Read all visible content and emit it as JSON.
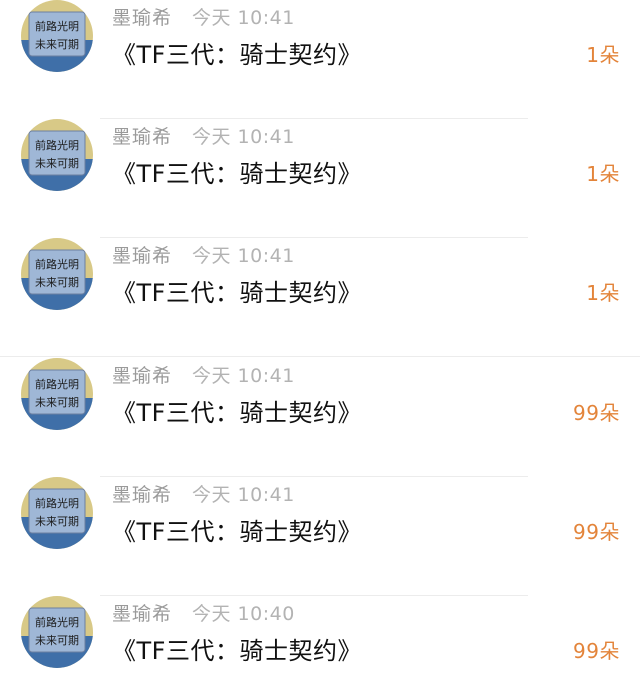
{
  "messages": [
    {
      "sender": "墨瑜希",
      "time": "今天 10:41",
      "gift": "《TF三代：骑士契约》",
      "count": "1朵"
    },
    {
      "sender": "墨瑜希",
      "time": "今天 10:41",
      "gift": "《TF三代：骑士契约》",
      "count": "1朵"
    },
    {
      "sender": "墨瑜希",
      "time": "今天 10:41",
      "gift": "《TF三代：骑士契约》",
      "count": "1朵"
    },
    {
      "sender": "墨瑜希",
      "time": "今天 10:41",
      "gift": "《TF三代：骑士契约》",
      "count": "99朵"
    },
    {
      "sender": "墨瑜希",
      "time": "今天 10:41",
      "gift": "《TF三代：骑士契约》",
      "count": "99朵"
    },
    {
      "sender": "墨瑜希",
      "time": "今天 10:40",
      "gift": "《TF三代：骑士契约》",
      "count": "99朵"
    }
  ],
  "avatar": {
    "icon": "avatar-image",
    "sky_color": "#d8c987",
    "sea_color": "#3f6fa8",
    "card_color": "#9fb7d6",
    "text_line_1": "前路光明",
    "text_line_2": "未来可期"
  }
}
